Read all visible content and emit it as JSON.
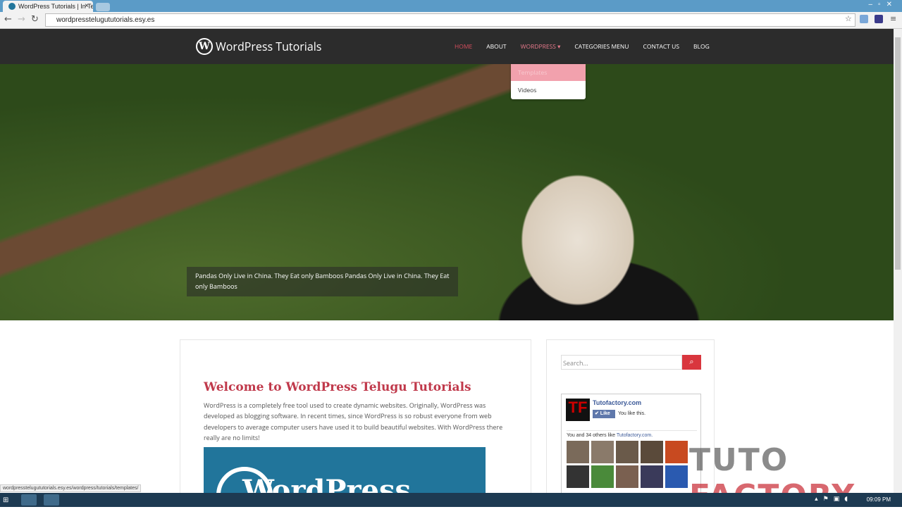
{
  "browser": {
    "tab_title": "WordPress Tutorials | In Te",
    "url": "wordpresstelugututorials.esy.es",
    "status_url": "wordpresstelugututorials.esy.es/wordpress/tutorials/templates/"
  },
  "site": {
    "logo_text": "WordPress Tutorials",
    "menu": [
      "HOME",
      "ABOUT",
      "WORDPRESS",
      "CATEGORIES MENU",
      "CONTACT US",
      "BLOG"
    ],
    "dropdown": [
      "Templates",
      "Videos"
    ],
    "hero_caption": "Pandas Only Live in China. They Eat only Bamboos Pandas Only Live in China. They Eat only Bamboos"
  },
  "post": {
    "title": "Welcome to WordPress Telugu Tutorials",
    "body": "WordPress is a completely free tool used to create dynamic websites. Originally, WordPress was developed as blogging software. In recent times, since WordPress is so robust everyone from web developers to average computer users have used it to build beautiful websites. With WordPress there really are no limits!",
    "image_text": "WordPress"
  },
  "sidebar": {
    "search_placeholder": "Search...",
    "fb_page": "Tutofactory.com",
    "like_label": "✔ Like",
    "you_like": "You like this.",
    "others_prefix": "You and 34 others like ",
    "others_link": "Tutofactory.com."
  },
  "watermark": {
    "a": "TUTO",
    "b": "FACTORY"
  },
  "taskbar": {
    "clock": "09:09 PM"
  }
}
